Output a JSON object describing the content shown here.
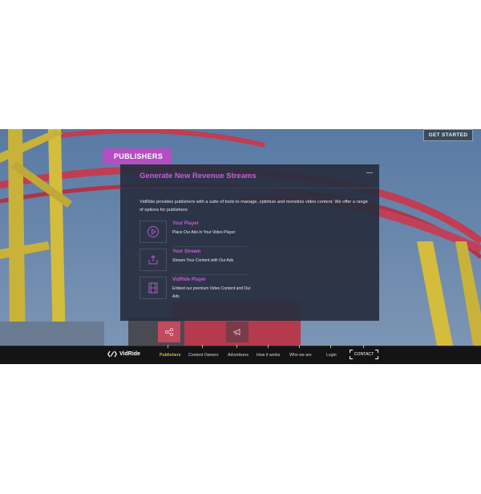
{
  "header": {
    "cta_label": "GET STARTED"
  },
  "section": {
    "tag": "PUBLISHERS",
    "title": "Generate New Revenue Streams",
    "description": "VidRide provides publishers with a suite of tools to manage, optimize and monetize video content. We offer a range of options for publishers:",
    "options": [
      {
        "title": "Your Player",
        "desc": "Place Our Ads in Your Video Player",
        "icon": "play-icon"
      },
      {
        "title": "Your Stream",
        "desc": "Stream Your Content with Our Ads",
        "icon": "upload-icon"
      },
      {
        "title": "VidRide Player",
        "desc": "Embed our premium Video Content and Our Ads",
        "icon": "film-icon"
      }
    ]
  },
  "bubbles": [
    {
      "icon": "share-icon"
    },
    {
      "icon": "megaphone-icon"
    }
  ],
  "navbar": {
    "logo_text": "VidRide",
    "links": [
      "Publishers",
      "Content Owners",
      "Advertisers",
      "How it works",
      "Who we are",
      "Login"
    ],
    "active": "Publishers",
    "contact_label": "CONTACT"
  },
  "colors": {
    "accent": "#c85cd8",
    "tag_bg": "#b44ec3",
    "nav_active": "#e0b640",
    "panel_bg": "#282e40"
  }
}
